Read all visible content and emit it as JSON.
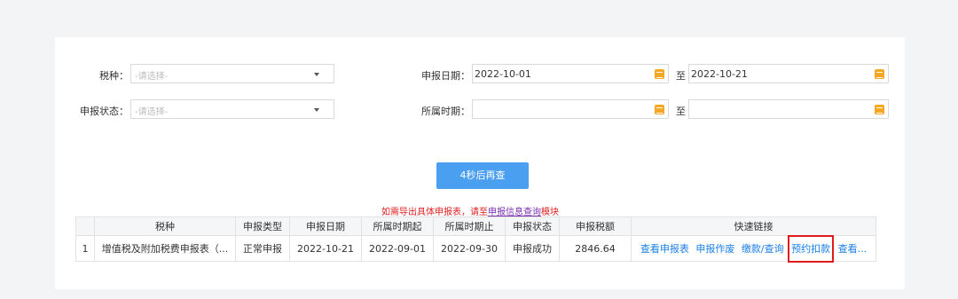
{
  "filters": {
    "tax_type_label": "税种：",
    "tax_type_placeholder": "-请选择-",
    "status_label": "申报状态：",
    "status_placeholder": "-请选择-",
    "filing_date_label": "申报日期：",
    "filing_date_from": "2022-10-01",
    "filing_date_to": "2022-10-21",
    "period_label": "所属时期：",
    "period_from": "",
    "period_to": "",
    "to_label": "至"
  },
  "refresh_button": "4秒后再查",
  "notice": {
    "prefix": "如需导出具体申报表，请至",
    "link": "申报信息查询",
    "suffix": "模块"
  },
  "table": {
    "headers": [
      "",
      "税种",
      "申报类型",
      "申报日期",
      "所属时期起",
      "所属时期止",
      "申报状态",
      "申报税额",
      "快速链接"
    ],
    "rows": [
      {
        "index": "1",
        "tax_type": "增值税及附加税费申报表（...",
        "filing_type": "正常申报",
        "filing_date": "2022-10-21",
        "period_start": "2022-09-01",
        "period_end": "2022-09-30",
        "status": "申报成功",
        "amount": "2846.64",
        "links": [
          "查看申报表",
          "申报作废",
          "缴款/查询",
          "预约扣款",
          "查看..."
        ]
      }
    ]
  },
  "colors": {
    "primary_button": "#4a9ff0",
    "link": "#1a7fe6",
    "notice": "#e02020",
    "highlight": "#e01b1b",
    "calendar_icon": "#f5a623"
  }
}
